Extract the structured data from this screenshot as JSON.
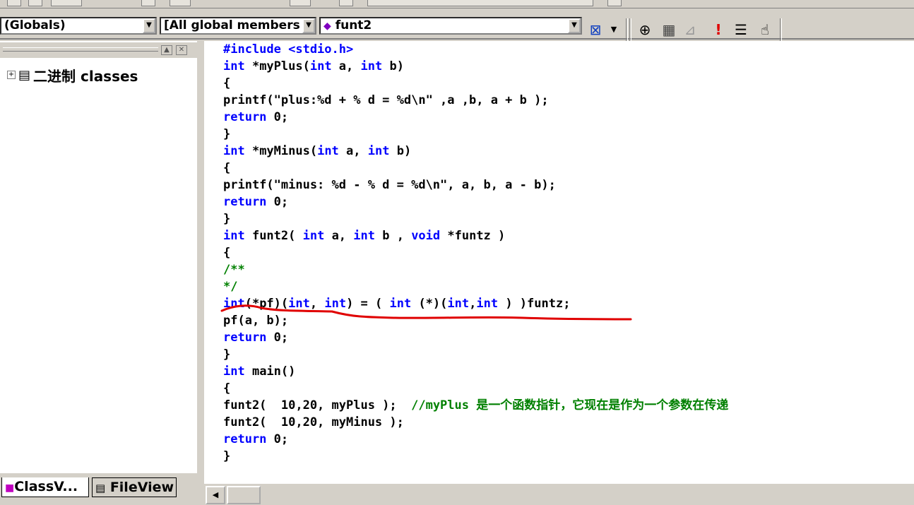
{
  "toolbar": {
    "scope_combo": "(Globals)",
    "members_combo": "[All global members",
    "function_combo": "funt2",
    "icons": [
      "wizard-icon",
      "build-icon",
      "compile-icon",
      "stop-icon",
      "execute-icon",
      "list-icon",
      "hand-icon"
    ]
  },
  "class_view": {
    "root_label": "二进制 classes"
  },
  "tabs": {
    "class_view": "ClassV...",
    "file_view": "FileView"
  },
  "code_lines": [
    [
      [
        "pp",
        "#include <stdio.h>"
      ]
    ],
    [
      [
        "kw",
        "int"
      ],
      [
        "t",
        " *myPlus("
      ],
      [
        "kw",
        "int"
      ],
      [
        "t",
        " a, "
      ],
      [
        "kw",
        "int"
      ],
      [
        "t",
        " b)"
      ]
    ],
    [
      [
        "t",
        "{"
      ]
    ],
    [
      [
        "t",
        "printf(\"plus:%d + % d = %d\\n\" ,a ,b, a + b );"
      ]
    ],
    [
      [
        "kw",
        "return"
      ],
      [
        "t",
        " 0;"
      ]
    ],
    [
      [
        "t",
        "}"
      ]
    ],
    [
      [
        "kw",
        "int"
      ],
      [
        "t",
        " *myMinus("
      ],
      [
        "kw",
        "int"
      ],
      [
        "t",
        " a, "
      ],
      [
        "kw",
        "int"
      ],
      [
        "t",
        " b)"
      ]
    ],
    [
      [
        "t",
        "{"
      ]
    ],
    [
      [
        "t",
        "printf(\"minus: %d - % d = %d\\n\", a, b, a - b);"
      ]
    ],
    [
      [
        "kw",
        "return"
      ],
      [
        "t",
        " 0;"
      ]
    ],
    [
      [
        "t",
        "}"
      ]
    ],
    [
      [
        "kw",
        "int"
      ],
      [
        "t",
        " funt2( "
      ],
      [
        "kw",
        "int"
      ],
      [
        "t",
        " a, "
      ],
      [
        "kw",
        "int"
      ],
      [
        "t",
        " b , "
      ],
      [
        "kw",
        "void"
      ],
      [
        "t",
        " *funtz )"
      ]
    ],
    [
      [
        "t",
        "{"
      ]
    ],
    [
      [
        "cm",
        "/**"
      ]
    ],
    [
      [
        "cm",
        "*/"
      ]
    ],
    [
      [
        "kw",
        "int"
      ],
      [
        "t",
        "(*pf)("
      ],
      [
        "kw",
        "int"
      ],
      [
        "t",
        ", "
      ],
      [
        "kw",
        "int"
      ],
      [
        "t",
        ") = ( "
      ],
      [
        "kw",
        "int"
      ],
      [
        "t",
        " (*)("
      ],
      [
        "kw",
        "int"
      ],
      [
        "t",
        ","
      ],
      [
        "kw",
        "int"
      ],
      [
        "t",
        " ) )funtz;"
      ]
    ],
    [
      [
        "t",
        "pf(a, b);"
      ]
    ],
    [
      [
        "kw",
        "return"
      ],
      [
        "t",
        " 0;"
      ]
    ],
    [
      [
        "t",
        "}"
      ]
    ],
    [
      [
        "kw",
        "int"
      ],
      [
        "t",
        " main()"
      ]
    ],
    [
      [
        "t",
        "{"
      ]
    ],
    [
      [
        "t",
        "funt2(  10,20, myPlus );  "
      ],
      [
        "cm",
        "//myPlus 是一个函数指针，它现在是作为一个参数在传递"
      ]
    ],
    [
      [
        "t",
        "funt2(  10,20, myMinus );"
      ]
    ],
    [
      [
        "kw",
        "return"
      ],
      [
        "t",
        " 0;"
      ]
    ],
    [
      [
        "t",
        "}"
      ]
    ]
  ],
  "colors": {
    "keyword": "#0000ff",
    "comment": "#008000",
    "preprocessor": "#0000ff",
    "annotation": "#e00000"
  }
}
